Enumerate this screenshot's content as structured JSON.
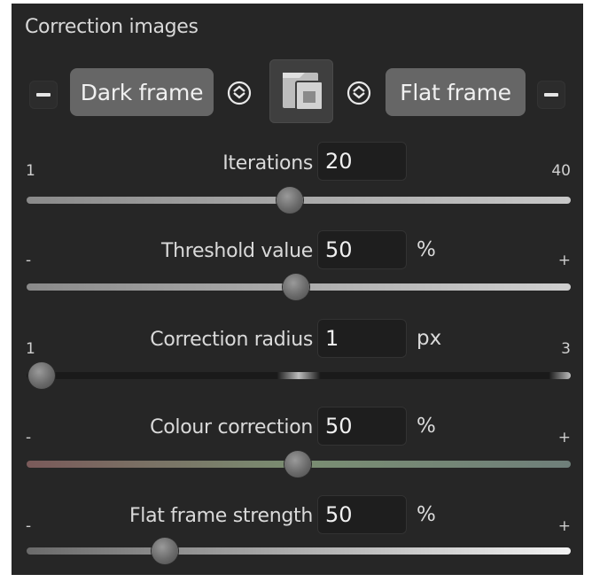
{
  "panel": {
    "title": "Correction images"
  },
  "frames": {
    "dark_label": "Dark frame",
    "flat_label": "Flat frame"
  },
  "rows": [
    {
      "label": "Iterations",
      "value": "20",
      "unit": "",
      "min": "1",
      "max": "40",
      "level": 0.5
    },
    {
      "label": "Threshold value",
      "value": "50",
      "unit": "%",
      "min": "-",
      "max": "+",
      "level": 0.5
    },
    {
      "label": "Correction radius",
      "value": "1",
      "unit": "px",
      "min": "1",
      "max": "3",
      "level": 0.0
    },
    {
      "label": "Colour correction",
      "value": "50",
      "unit": "%",
      "min": "-",
      "max": "+",
      "level": 0.5
    },
    {
      "label": "Flat frame strength",
      "value": "50",
      "unit": "%",
      "min": "-",
      "max": "+",
      "level": 0.25
    }
  ],
  "icons": {
    "remove_dark": "minus-icon",
    "remove_flat": "minus-icon",
    "cycle_left": "cycle-icon",
    "cycle_right": "cycle-icon",
    "preview": "frames-stack-icon"
  },
  "colors": {
    "panel_bg": "#262626",
    "button_bg": "#666666",
    "value_bg": "#1e1e1e"
  }
}
